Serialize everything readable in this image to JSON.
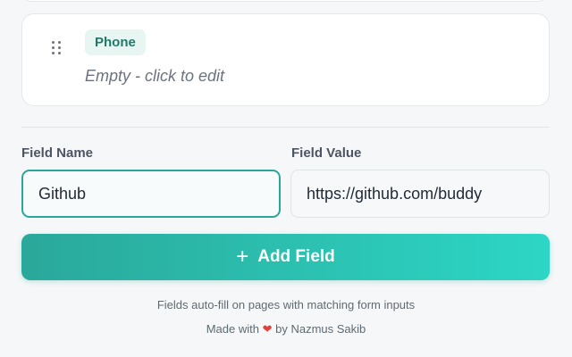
{
  "field_card": {
    "badge": "Phone",
    "value_placeholder": "Empty - click to edit"
  },
  "form": {
    "field_name_label": "Field Name",
    "field_value_label": "Field Value",
    "field_name_value": "Github",
    "field_value_value": "https://github.com/buddy",
    "add_button_label": "Add Field"
  },
  "footer": {
    "hint": "Fields auto-fill on pages with matching form inputs",
    "credit_prefix": "Made with",
    "credit_suffix": "by Nazmus Sakib"
  },
  "colors": {
    "accent": "#2aa69a",
    "accent_light": "#2dd6c5",
    "badge_bg": "#e7f6f3",
    "heart": "#e0413d"
  },
  "icons": {
    "drag": "drag-handle-icon",
    "add": "plus-icon",
    "heart": "heart-icon"
  }
}
